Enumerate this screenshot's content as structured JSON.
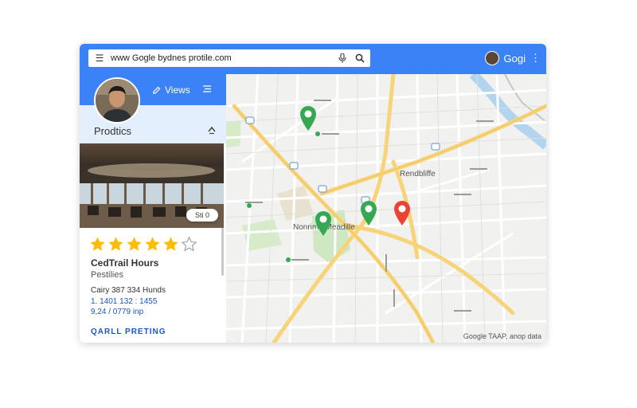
{
  "search": {
    "url": "www Gogle bydnes protile.com"
  },
  "account": {
    "name": "Gogi"
  },
  "sidebar": {
    "views_label": "Views",
    "profiles_label": "Prodtics",
    "photo_badge": "Sti 0",
    "rating_stars": 5,
    "rating_max": 6,
    "business_name": "CedTrail Hours",
    "business_category": "Pestilies",
    "info_lines": [
      "Cairy 387 334 Hunds",
      "1. 1401 132 : 1455",
      "9,24 / 0779 inp"
    ],
    "cta": "QARLL PRETING"
  },
  "map": {
    "labels": [
      "Nonrimd Meadille",
      "Rendbliffe"
    ],
    "credit": "Google TAAP, anop data"
  },
  "colors": {
    "accent": "#3b82f6",
    "pin_green": "#34a853",
    "pin_red": "#ea4335",
    "star": "#fbbc04"
  }
}
